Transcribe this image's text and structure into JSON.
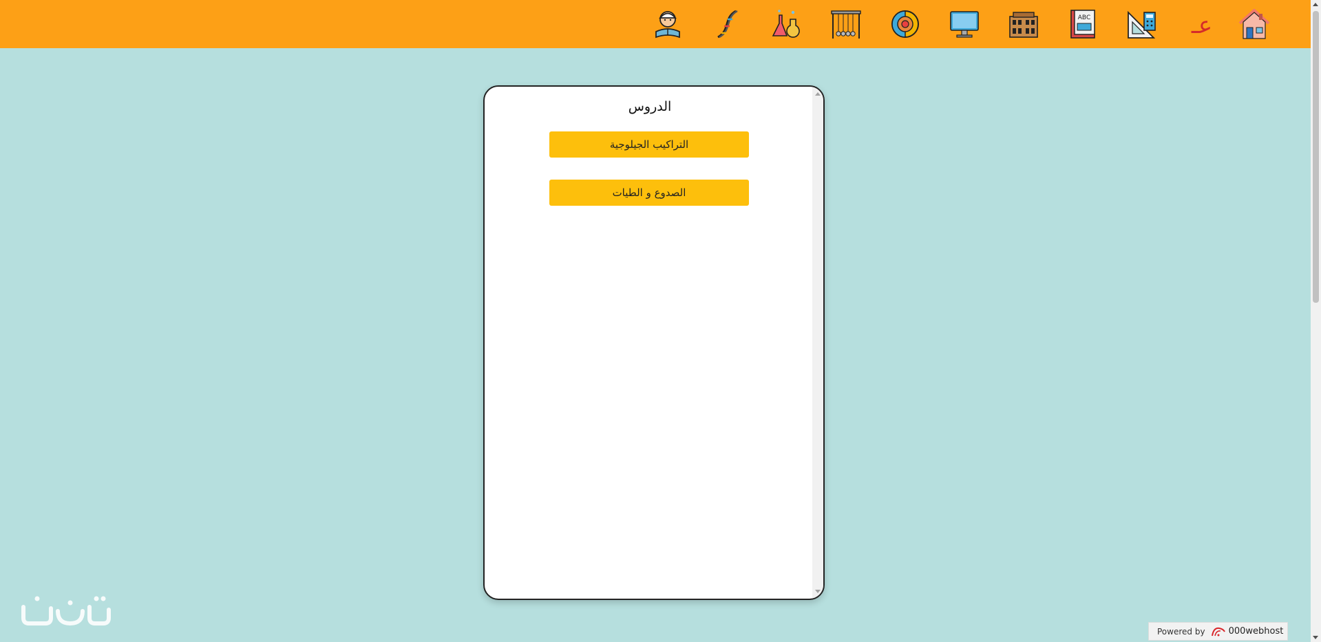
{
  "header": {
    "background": "#fda016",
    "icons": [
      {
        "name": "home-icon"
      },
      {
        "name": "arabic-letter-icon",
        "label": "عـ"
      },
      {
        "name": "math-tools-icon"
      },
      {
        "name": "abc-book-icon",
        "label": "ABC"
      },
      {
        "name": "history-building-icon"
      },
      {
        "name": "computer-icon"
      },
      {
        "name": "earth-globe-icon"
      },
      {
        "name": "newtons-cradle-icon"
      },
      {
        "name": "chemistry-flasks-icon"
      },
      {
        "name": "dna-icon"
      },
      {
        "name": "quran-reader-icon"
      }
    ]
  },
  "lessons": {
    "title": "الدروس",
    "items": [
      {
        "label": "التراكيب الجيلوجية"
      },
      {
        "label": "الصدوع و الطيات"
      }
    ],
    "button_color": "#fdbf0c"
  },
  "footer": {
    "powered_label": "Powered by",
    "powered_brand": "000webhost"
  },
  "colors": {
    "page_background": "#b6dfde",
    "card_background": "#ffffff"
  }
}
